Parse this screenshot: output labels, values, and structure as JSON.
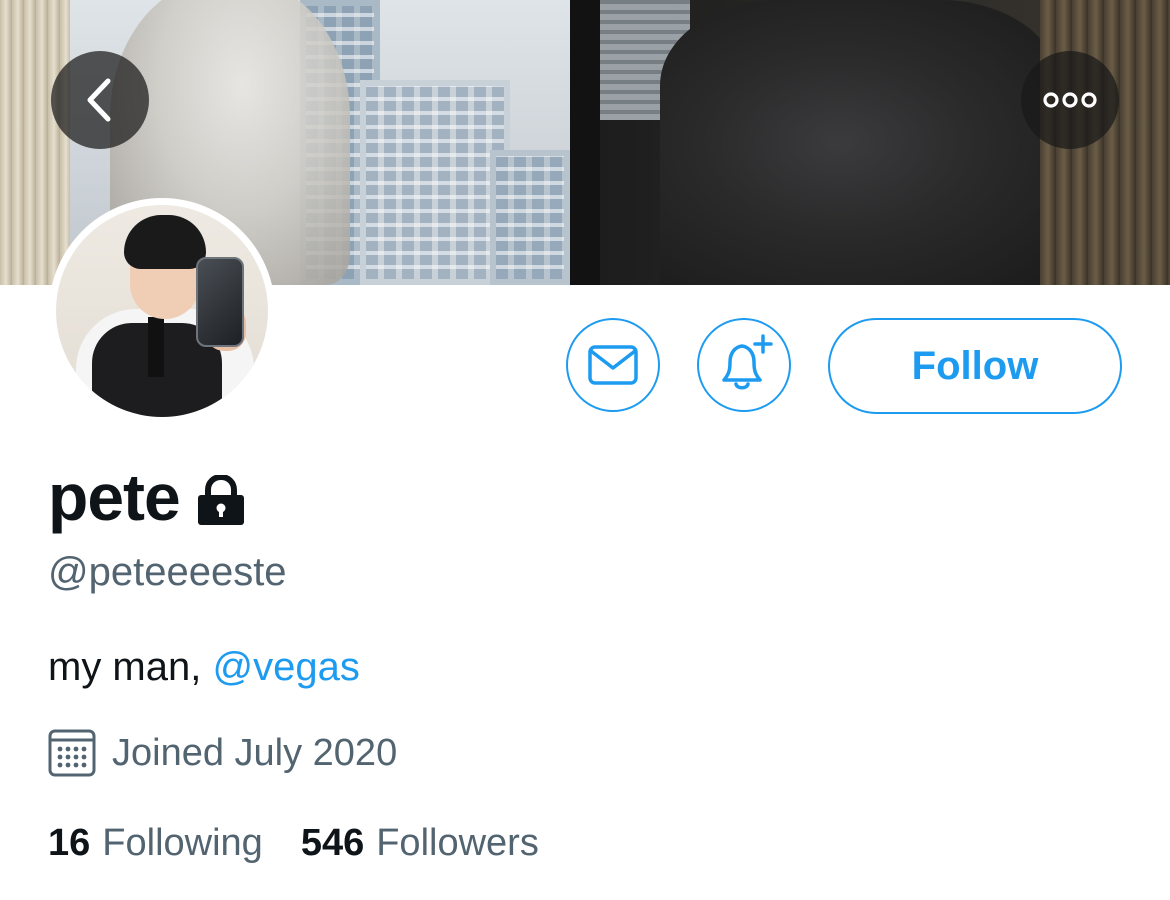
{
  "header": {
    "back_icon": "chevron-left-icon",
    "more_icon": "more-horizontal-icon"
  },
  "profile": {
    "display_name": "pete",
    "protected_icon": "lock-icon",
    "handle": "@peteeeeste",
    "bio_text": "my man, ",
    "bio_mention": "@vegas",
    "joined_icon": "calendar-icon",
    "joined": "Joined July 2020",
    "following_count": "16",
    "following_label": "Following",
    "followers_count": "546",
    "followers_label": "Followers"
  },
  "actions": {
    "message_icon": "mail-icon",
    "notify_icon": "bell-plus-icon",
    "follow_label": "Follow"
  },
  "colors": {
    "accent": "#1d9bf0",
    "text_primary": "#0f1419",
    "text_secondary": "#536471"
  }
}
